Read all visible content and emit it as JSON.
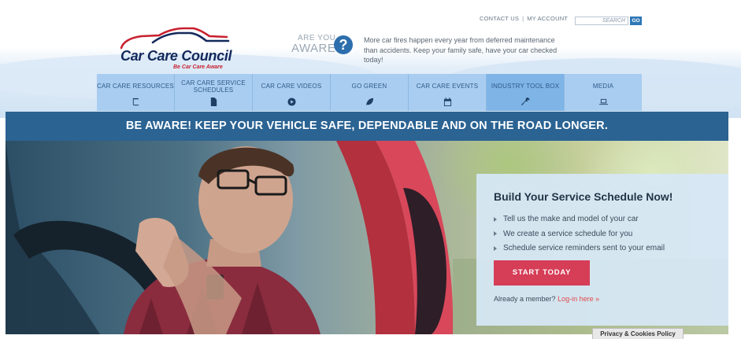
{
  "utility": {
    "contact_label": "CONTACT US",
    "separator": "|",
    "account_label": "MY ACCOUNT",
    "search_placeholder": "SEARCH",
    "go_label": "GO"
  },
  "logo": {
    "name": "Car Care Council",
    "tagline": "Be Car Care Aware"
  },
  "aware": {
    "small": "ARE YOU",
    "big": "AWARE",
    "icon": "question-icon",
    "text": "More car fires happen every year from deferred maintenance than accidents. Keep your family safe, have your car checked today!"
  },
  "nav": {
    "items": [
      {
        "label": "CAR CARE RESOURCES",
        "icon": "book-icon"
      },
      {
        "label": "CAR CARE SERVICE SCHEDULES",
        "icon": "document-icon"
      },
      {
        "label": "CAR CARE VIDEOS",
        "icon": "play-icon"
      },
      {
        "label": "GO GREEN",
        "icon": "leaf-icon"
      },
      {
        "label": "CAR CARE EVENTS",
        "icon": "calendar-icon"
      },
      {
        "label": "INDUSTRY TOOL BOX",
        "icon": "wrench-icon"
      },
      {
        "label": "MEDIA",
        "icon": "laptop-icon"
      }
    ]
  },
  "banner": {
    "text": "BE AWARE! KEEP YOUR VEHICLE SAFE, DEPENDABLE AND ON THE ROAD LONGER."
  },
  "panel": {
    "title": "Build Your Service Schedule Now!",
    "bullets": [
      "Tell us the make and model of your car",
      "We create a service schedule for you",
      "Schedule service reminders sent to your email"
    ],
    "cta": "START TODAY",
    "member_text": "Already a member?",
    "login_link": "Log-in here »"
  },
  "privacy": {
    "label": "Privacy & Cookies Policy"
  },
  "colors": {
    "brand_navy": "#13295b",
    "brand_red": "#c8202f",
    "nav_bg": "#a9cdf0",
    "banner_bg": "#2b6393",
    "cta_bg": "#d63d57"
  }
}
